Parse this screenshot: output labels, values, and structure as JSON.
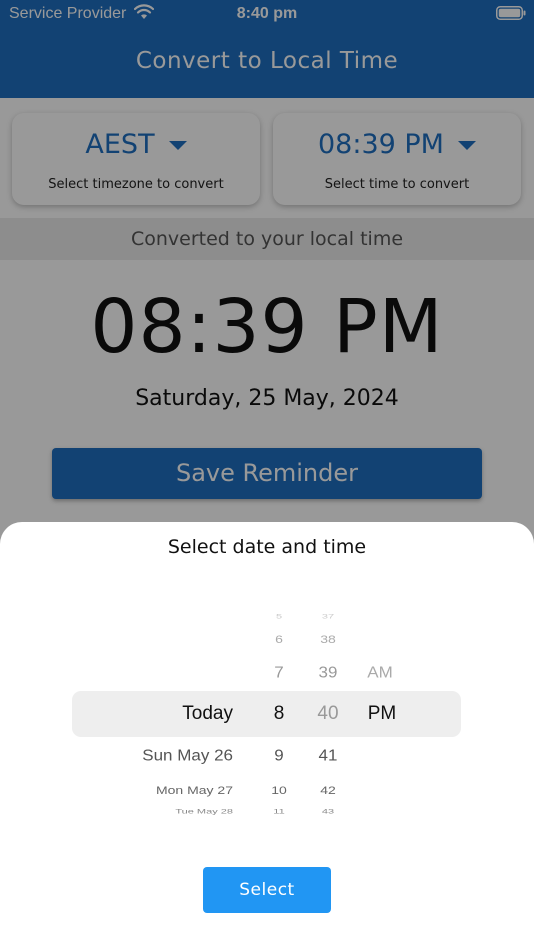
{
  "status_bar": {
    "carrier": "Service Provider",
    "time": "8:40 pm"
  },
  "header": {
    "title": "Convert to Local Time"
  },
  "timezone_card": {
    "value": "AEST",
    "caption": "Select timezone to convert"
  },
  "time_card": {
    "value": "08:39 PM",
    "caption": "Select time to convert"
  },
  "converted": {
    "banner": "Converted to your local time",
    "time": "08:39 PM",
    "date": "Saturday, 25 May, 2024"
  },
  "save_button": {
    "label": "Save Reminder"
  },
  "sheet": {
    "title": "Select date and time",
    "date_col": [
      "Today",
      "Sun May 26",
      "Mon May 27",
      "Tue May 28"
    ],
    "hour_col": [
      "5",
      "6",
      "7",
      "8",
      "9",
      "10",
      "11"
    ],
    "minute_col": [
      "37",
      "38",
      "39",
      "40",
      "41",
      "42",
      "43"
    ],
    "ampm_col": [
      "AM",
      "PM"
    ],
    "select_label": "Select"
  },
  "colors": {
    "primary": "#1e6fc0",
    "select_button": "#2196f3"
  }
}
